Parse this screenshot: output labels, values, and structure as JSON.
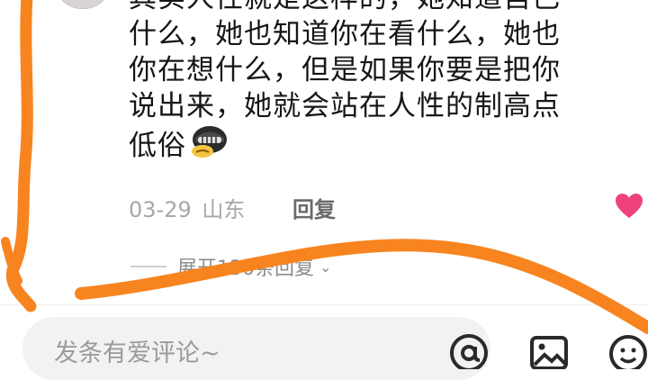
{
  "comment": {
    "lines": [
      "其实人性就是这样的，她知道自己",
      "什么，她也知道你在看什么，她也",
      "你在想什么，但是如果你要是把你",
      "说出来，她就会站在人性的制高点",
      "低俗"
    ],
    "emoji": "helmet-grimace-emoji",
    "date": "03-29",
    "location": "山东",
    "reply_label": "回复"
  },
  "replies": {
    "expand_label": "展开130条回复",
    "chevron": "chevron-down-icon"
  },
  "input": {
    "placeholder": "发条有爱评论~"
  },
  "icons": [
    "at-icon",
    "image-icon",
    "emoji-icon",
    "heart-icon"
  ],
  "colors": {
    "heart": "#f0427a",
    "scribble": "#f7841f"
  }
}
